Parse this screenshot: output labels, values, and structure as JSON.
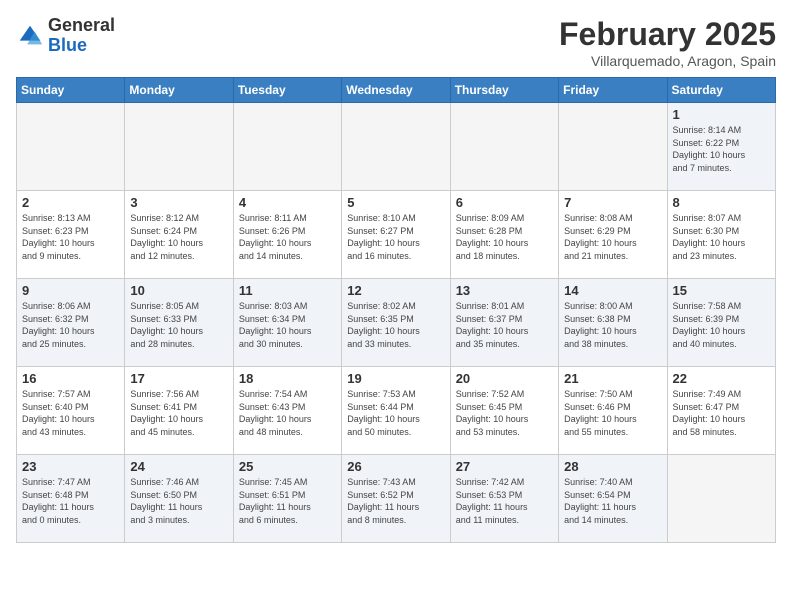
{
  "header": {
    "logo": {
      "general": "General",
      "blue": "Blue"
    },
    "title": "February 2025",
    "location": "Villarquemado, Aragon, Spain"
  },
  "days_of_week": [
    "Sunday",
    "Monday",
    "Tuesday",
    "Wednesday",
    "Thursday",
    "Friday",
    "Saturday"
  ],
  "weeks": [
    [
      {
        "day": "",
        "info": "",
        "empty": true
      },
      {
        "day": "",
        "info": "",
        "empty": true
      },
      {
        "day": "",
        "info": "",
        "empty": true
      },
      {
        "day": "",
        "info": "",
        "empty": true
      },
      {
        "day": "",
        "info": "",
        "empty": true
      },
      {
        "day": "",
        "info": "",
        "empty": true
      },
      {
        "day": "1",
        "info": "Sunrise: 8:14 AM\nSunset: 6:22 PM\nDaylight: 10 hours\nand 7 minutes."
      }
    ],
    [
      {
        "day": "2",
        "info": "Sunrise: 8:13 AM\nSunset: 6:23 PM\nDaylight: 10 hours\nand 9 minutes."
      },
      {
        "day": "3",
        "info": "Sunrise: 8:12 AM\nSunset: 6:24 PM\nDaylight: 10 hours\nand 12 minutes."
      },
      {
        "day": "4",
        "info": "Sunrise: 8:11 AM\nSunset: 6:26 PM\nDaylight: 10 hours\nand 14 minutes."
      },
      {
        "day": "5",
        "info": "Sunrise: 8:10 AM\nSunset: 6:27 PM\nDaylight: 10 hours\nand 16 minutes."
      },
      {
        "day": "6",
        "info": "Sunrise: 8:09 AM\nSunset: 6:28 PM\nDaylight: 10 hours\nand 18 minutes."
      },
      {
        "day": "7",
        "info": "Sunrise: 8:08 AM\nSunset: 6:29 PM\nDaylight: 10 hours\nand 21 minutes."
      },
      {
        "day": "8",
        "info": "Sunrise: 8:07 AM\nSunset: 6:30 PM\nDaylight: 10 hours\nand 23 minutes."
      }
    ],
    [
      {
        "day": "9",
        "info": "Sunrise: 8:06 AM\nSunset: 6:32 PM\nDaylight: 10 hours\nand 25 minutes."
      },
      {
        "day": "10",
        "info": "Sunrise: 8:05 AM\nSunset: 6:33 PM\nDaylight: 10 hours\nand 28 minutes."
      },
      {
        "day": "11",
        "info": "Sunrise: 8:03 AM\nSunset: 6:34 PM\nDaylight: 10 hours\nand 30 minutes."
      },
      {
        "day": "12",
        "info": "Sunrise: 8:02 AM\nSunset: 6:35 PM\nDaylight: 10 hours\nand 33 minutes."
      },
      {
        "day": "13",
        "info": "Sunrise: 8:01 AM\nSunset: 6:37 PM\nDaylight: 10 hours\nand 35 minutes."
      },
      {
        "day": "14",
        "info": "Sunrise: 8:00 AM\nSunset: 6:38 PM\nDaylight: 10 hours\nand 38 minutes."
      },
      {
        "day": "15",
        "info": "Sunrise: 7:58 AM\nSunset: 6:39 PM\nDaylight: 10 hours\nand 40 minutes."
      }
    ],
    [
      {
        "day": "16",
        "info": "Sunrise: 7:57 AM\nSunset: 6:40 PM\nDaylight: 10 hours\nand 43 minutes."
      },
      {
        "day": "17",
        "info": "Sunrise: 7:56 AM\nSunset: 6:41 PM\nDaylight: 10 hours\nand 45 minutes."
      },
      {
        "day": "18",
        "info": "Sunrise: 7:54 AM\nSunset: 6:43 PM\nDaylight: 10 hours\nand 48 minutes."
      },
      {
        "day": "19",
        "info": "Sunrise: 7:53 AM\nSunset: 6:44 PM\nDaylight: 10 hours\nand 50 minutes."
      },
      {
        "day": "20",
        "info": "Sunrise: 7:52 AM\nSunset: 6:45 PM\nDaylight: 10 hours\nand 53 minutes."
      },
      {
        "day": "21",
        "info": "Sunrise: 7:50 AM\nSunset: 6:46 PM\nDaylight: 10 hours\nand 55 minutes."
      },
      {
        "day": "22",
        "info": "Sunrise: 7:49 AM\nSunset: 6:47 PM\nDaylight: 10 hours\nand 58 minutes."
      }
    ],
    [
      {
        "day": "23",
        "info": "Sunrise: 7:47 AM\nSunset: 6:48 PM\nDaylight: 11 hours\nand 0 minutes."
      },
      {
        "day": "24",
        "info": "Sunrise: 7:46 AM\nSunset: 6:50 PM\nDaylight: 11 hours\nand 3 minutes."
      },
      {
        "day": "25",
        "info": "Sunrise: 7:45 AM\nSunset: 6:51 PM\nDaylight: 11 hours\nand 6 minutes."
      },
      {
        "day": "26",
        "info": "Sunrise: 7:43 AM\nSunset: 6:52 PM\nDaylight: 11 hours\nand 8 minutes."
      },
      {
        "day": "27",
        "info": "Sunrise: 7:42 AM\nSunset: 6:53 PM\nDaylight: 11 hours\nand 11 minutes."
      },
      {
        "day": "28",
        "info": "Sunrise: 7:40 AM\nSunset: 6:54 PM\nDaylight: 11 hours\nand 14 minutes."
      },
      {
        "day": "",
        "info": "",
        "empty": true
      }
    ]
  ]
}
